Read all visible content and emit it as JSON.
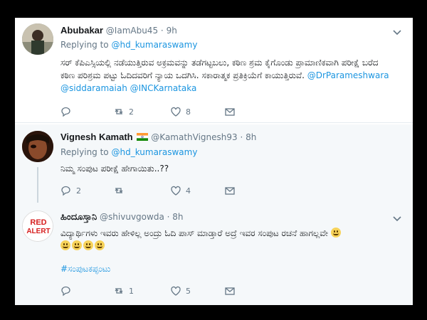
{
  "tweets": [
    {
      "name": "Abubakar",
      "handle": "@IamAbu45",
      "separator": "·",
      "time": "9h",
      "replying_prefix": "Replying to",
      "replying_to": "@hd_kumaraswamy",
      "text": "ಸರ್ ಕೆಪಿಎಸ್ಸಿಯಲ್ಲಿ ನಡೆಯುತ್ತಿರುವ ಅಕ್ರಮವನ್ನು ತಡೆಗಟ್ಟಬಲು, ಕಠಿಣ ಶ್ರಮ ಕೈಗೊಂಡು ಪ್ರಾಮಾಣಿಕವಾಗಿ ಪರೀಕ್ಷೆ ಬರೆದ ಕಠಿಣ ಪರಿಶ್ರಮ ಪಟ್ಟು ಓದಿದವರಿಗೆ ನ್ಯಾಯ ಒದಗಿಸಿ. ಸಕಾರಾತ್ಮಕ ಪ್ರತಿಕ್ರಿಯೆಗೆ ಕಾಯುತ್ತಿರುವೆ.",
      "mentions": "@DrParameshwara @siddaramaiah @INCKarnataka",
      "reply_count": "",
      "retweet_count": "2",
      "like_count": "8"
    },
    {
      "name": "Vignesh Kamath",
      "handle": "@KamathVignesh93",
      "separator": "·",
      "time": "8h",
      "replying_prefix": "Replying to",
      "replying_to": "@hd_kumaraswamy",
      "text": "ನಿಮ್ಮ ಸಂಪುಟ ಪರೀಕ್ಷೆ ಹೇಗಾಯಿತು..??",
      "reply_count": "2",
      "retweet_count": "",
      "like_count": "4"
    },
    {
      "name": "ಹಿಂದೂಸ್ತಾನಿ",
      "handle": "@shivuvgowda",
      "separator": "·",
      "time": "8h",
      "avatar_text": "RED ALERT",
      "text": "ವಿದ್ಯಾರ್ಥಿಗಳು ಇವರು ಹೇಳಿಲ್ಲ ಅಂದ್ರು ಓದಿ ಪಾಸ್ ಮಾಡ್ತಾರೆ ಅದ್ರೆ ಇವರ ಸಂಪುಟ ರಚನೆ ಹಾಗಲ್ಲವೇ",
      "hashtag": "#ಸಂಪುಟಕಪ್ಫಂಟು",
      "reply_count": "",
      "retweet_count": "1",
      "like_count": "5"
    }
  ],
  "colors": {
    "link": "#1b95e0",
    "secondary": "#657786",
    "thread_bg": "#f5f8fa"
  }
}
